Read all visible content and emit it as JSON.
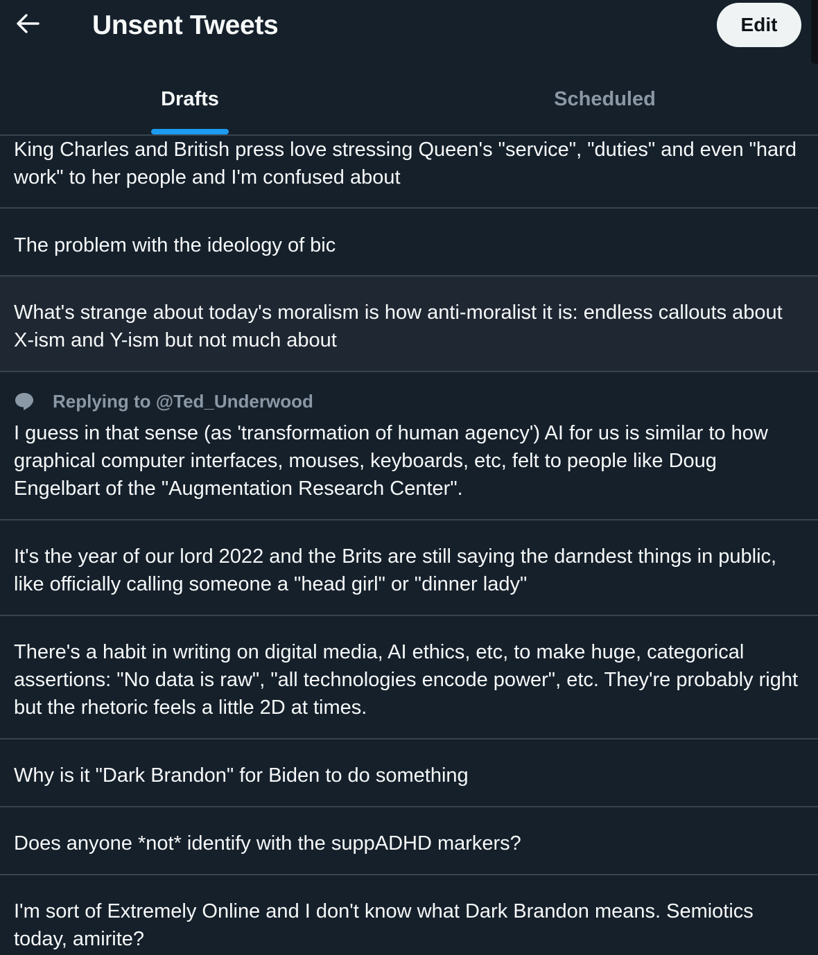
{
  "header": {
    "title": "Unsent Tweets",
    "edit_label": "Edit",
    "back_icon": "arrow-left-icon"
  },
  "tabs": [
    {
      "label": "Drafts",
      "selected": true
    },
    {
      "label": "Scheduled",
      "selected": false
    }
  ],
  "colors": {
    "background": "#15202b",
    "accent": "#1d9bf0",
    "divider": "#38444d",
    "muted_text": "#8b98a5"
  },
  "drafts": [
    {
      "text": "King Charles and British press love stressing Queen's \"service\", \"duties\" and even \"hard work\" to her people and I'm confused about"
    },
    {
      "text": "The problem with the ideology of bic"
    },
    {
      "text": "What's strange about today's moralism is how anti-moralist it is: endless callouts about X-ism and Y-ism but not much about"
    },
    {
      "reply_to": "Replying to @Ted_Underwood",
      "reply_icon": "speech-bubble-icon",
      "text": "I guess in that sense (as 'transformation of human agency') AI for us is similar to how graphical computer interfaces, mouses, keyboards, etc, felt to people like Doug Engelbart of the \"Augmentation Research Center\"."
    },
    {
      "text": "It's the year of our lord 2022 and the Brits are still saying the darndest things in public, like officially calling someone a \"head girl\" or \"dinner lady\""
    },
    {
      "text": "There's a habit in writing on digital media, AI ethics, etc, to make huge, categorical assertions: \"No data is raw\", \"all technologies encode power\", etc. They're probably right but the rhetoric feels a little 2D at times."
    },
    {
      "text": "Why is it \"Dark Brandon\" for Biden to do something"
    },
    {
      "text": "Does anyone *not* identify with the suppADHD markers?"
    },
    {
      "text": "I'm sort of Extremely Online and I don't know what Dark Brandon means. Semiotics today, amirite?"
    }
  ]
}
